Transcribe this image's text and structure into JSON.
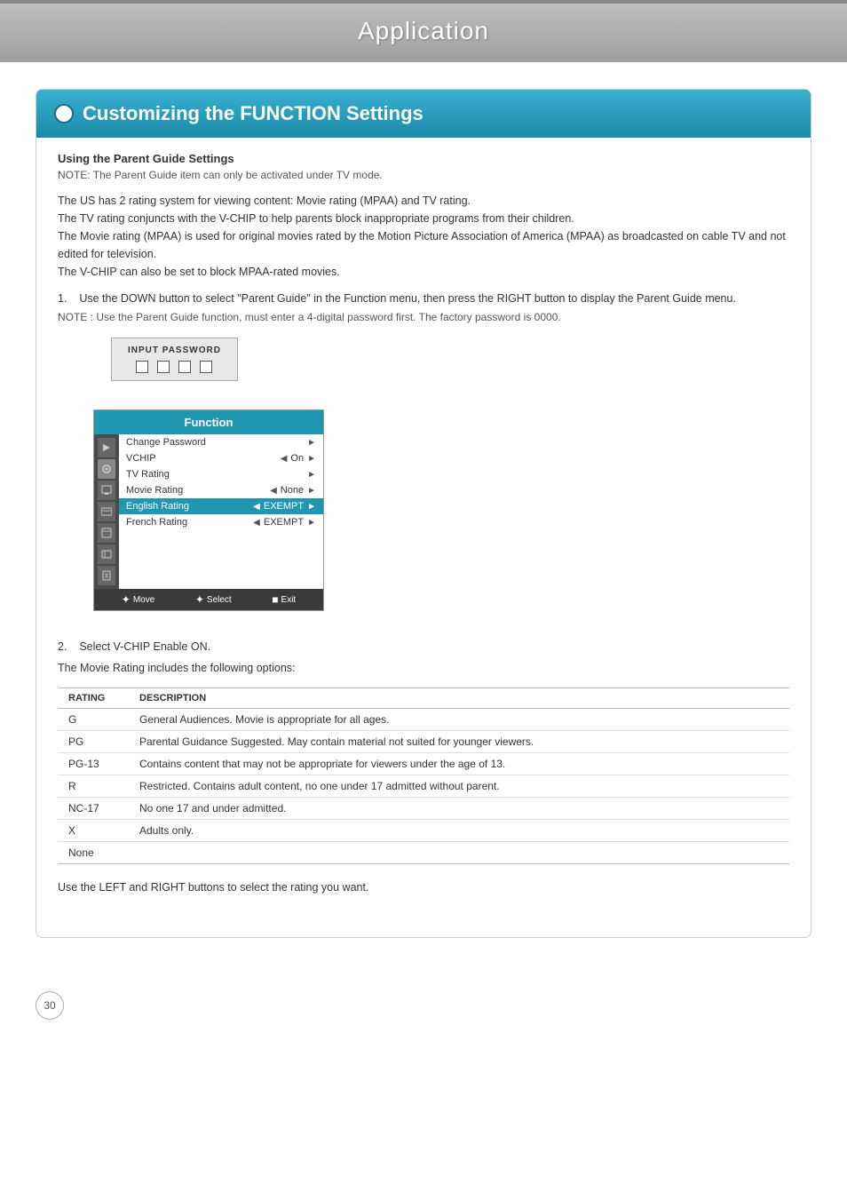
{
  "header": {
    "title": "Application"
  },
  "section": {
    "title": "Customizing the FUNCTION Settings",
    "using_parent_guide": {
      "subtitle": "Using the Parent Guide Settings",
      "note": "NOTE: The Parent Guide item can only be activated under TV mode.",
      "body_lines": [
        "The US has 2 rating system for viewing content: Movie rating (MPAA) and TV rating.",
        "The TV rating conjuncts with the V-CHIP to help parents block inappropriate programs from their children.",
        "The Movie rating (MPAA) is used for original movies rated by the Motion Picture Association of America (MPAA) as broadcasted on cable TV and not edited for television.",
        "The V-CHIP can also be set to block MPAA-rated movies."
      ]
    },
    "step1": {
      "number": "1.",
      "text": "Use the DOWN button to select \"Parent Guide\" in the Function menu, then press the RIGHT button to display the Parent Guide menu.",
      "note": "NOTE : Use the Parent Guide function, must enter a 4-digital password first. The factory password is 0000."
    },
    "input_password": {
      "label": "INPUT PASSWORD"
    },
    "function_menu": {
      "header": "Function",
      "items": [
        {
          "name": "Change Password",
          "value": "",
          "has_left": false,
          "has_right": true,
          "highlighted": false
        },
        {
          "name": "VCHIP",
          "value": "On",
          "has_left": true,
          "has_right": true,
          "highlighted": false
        },
        {
          "name": "TV Rating",
          "value": "",
          "has_left": false,
          "has_right": true,
          "highlighted": false
        },
        {
          "name": "Movie Rating",
          "value": "None",
          "has_left": true,
          "has_right": true,
          "highlighted": false
        },
        {
          "name": "English Rating",
          "value": "EXEMPT",
          "has_left": true,
          "has_right": true,
          "highlighted": true
        },
        {
          "name": "French Rating",
          "value": "EXEMPT",
          "has_left": true,
          "has_right": true,
          "highlighted": false
        }
      ],
      "footer": [
        {
          "icon": "✦",
          "label": "Move"
        },
        {
          "icon": "✦",
          "label": "Select"
        },
        {
          "icon": "■",
          "label": "Exit"
        }
      ]
    },
    "step2": {
      "number": "2.",
      "text": "Select V-CHIP Enable ON.",
      "sub_text": "The Movie Rating includes the following options:"
    },
    "rating_table": {
      "columns": [
        "RATING",
        "DESCRIPTION"
      ],
      "rows": [
        {
          "rating": "G",
          "description": "General Audiences. Movie is appropriate for all ages."
        },
        {
          "rating": "PG",
          "description": "Parental Guidance Suggested. May contain material not suited for younger viewers."
        },
        {
          "rating": "PG-13",
          "description": "Contains content that may not be appropriate for viewers under the age of 13."
        },
        {
          "rating": "R",
          "description": "Restricted. Contains adult content, no one under 17 admitted without parent."
        },
        {
          "rating": "NC-17",
          "description": "No one 17 and under admitted."
        },
        {
          "rating": "X",
          "description": "Adults only."
        },
        {
          "rating": "None",
          "description": ""
        }
      ]
    },
    "closing_text": "Use the LEFT and RIGHT buttons to select the rating you want."
  },
  "page_number": "30"
}
